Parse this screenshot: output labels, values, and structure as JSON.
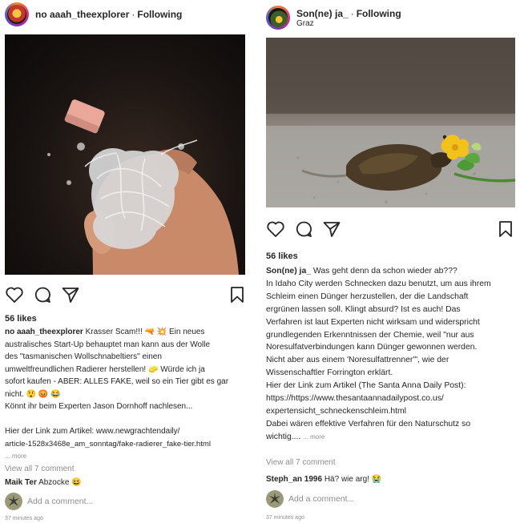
{
  "left_post": {
    "username": "no aaah_theexplorer",
    "separator": "·",
    "following_label": "Following",
    "likes": "56 likes",
    "caption_user": "no aaah_theexplorer",
    "caption_lines": [
      "Krasser Scam!!! 🔫 💥 Ein neues",
      "australisches Start-Up behauptet man kann aus der Wolle",
      "des \"tasmanischen Wollschnabeltiers\" einen",
      "umweltfreundlichen Radierer herstellen! 🧽 Würde ich ja",
      "sofort kaufen - ABER: ALLES FAKE, weil so ein Tier gibt es gar",
      "nicht. 😲 😡 😂",
      "Könnt ihr beim Experten Jason Dornhoff nachlesen...",
      "",
      "Hier der Link zum Artikel: www.newgrachtendaily/",
      "article-1528x3468e_am_sonntag/fake-radierer_fake-tier.html"
    ],
    "more_label": "... more",
    "view_all": "View all 7 comment",
    "comment_user": "Maik Ter",
    "comment_text": "Abzocke 😆",
    "add_comment_placeholder": "Add a comment...",
    "time": "37 minutes ago"
  },
  "right_post": {
    "username": "Son(ne) ja_",
    "separator": "·",
    "following_label": "Following",
    "location": "Graz",
    "likes": "56 likes",
    "caption_user": "Son(ne) ja_",
    "caption_first": "Was geht denn da schon wieder ab???",
    "caption_lines": [
      "In Idaho City werden Schnecken dazu benutzt, um aus ihrem",
      "Schleim einen Dünger herzustellen, der die Landschaft",
      "ergrünen lassen soll. Klingt absurd? Ist es auch! Das",
      "Verfahren ist laut Experten nicht wirksam und widerspricht",
      "grundlegenden Erkenntnissen der Chemie, weil \"nur aus",
      "Noresulfatverbindungen kann Dünger gewonnen werden.",
      "Nicht aber aus einem 'Noresulfattrenner'\", wie der",
      "Wissenschaftler Forrington erklärt.",
      "Hier der Link zum Artikel (The Santa Anna Daily Post):",
      "https://https://www.thesantaannadailypost.co.us/",
      "expertensicht_schneckenschleim.html",
      "Dabei wären effektive Verfahren für den Naturschutz so"
    ],
    "caption_last": "wichtig....",
    "more_label": "... more",
    "view_all": "View all 7 comment",
    "comment_user": "Steph_an 1996",
    "comment_text": "Hä? wie arg! 😭",
    "add_comment_placeholder": "Add a comment...",
    "time": "37 minutes ago"
  },
  "icons": [
    "heart-icon",
    "comment-icon",
    "share-icon",
    "bookmark-icon"
  ]
}
